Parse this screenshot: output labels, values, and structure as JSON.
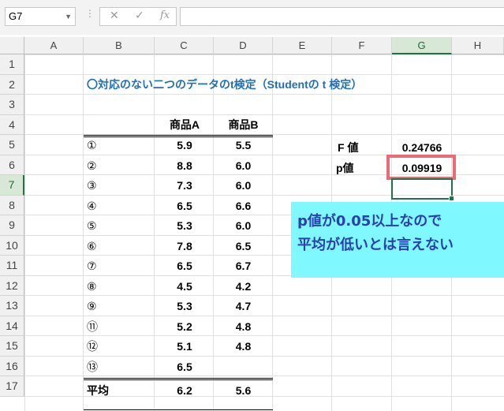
{
  "formula_bar": {
    "name_box": "G7",
    "cancel_icon": "✕",
    "enter_icon": "✓",
    "fx_label": "fx",
    "formula": ""
  },
  "columns": [
    "A",
    "B",
    "C",
    "D",
    "E",
    "F",
    "G",
    "H"
  ],
  "rows": [
    "1",
    "2",
    "3",
    "4",
    "5",
    "6",
    "7",
    "8",
    "9",
    "10",
    "11",
    "12",
    "13",
    "14",
    "15",
    "16",
    "17"
  ],
  "selected": {
    "column": "G",
    "row": "7"
  },
  "sheet": {
    "title": "〇対応のない二つのデータのt検定（Studentの t 検定）",
    "header_a": "商品A",
    "header_b": "商品B",
    "table_rows": [
      {
        "label": "①",
        "a": "5.9",
        "b": "5.5"
      },
      {
        "label": "②",
        "a": "8.8",
        "b": "6.0"
      },
      {
        "label": "③",
        "a": "7.3",
        "b": "6.0"
      },
      {
        "label": "④",
        "a": "6.5",
        "b": "6.6"
      },
      {
        "label": "⑤",
        "a": "5.3",
        "b": "6.0"
      },
      {
        "label": "⑥",
        "a": "7.8",
        "b": "6.5"
      },
      {
        "label": "⑦",
        "a": "6.5",
        "b": "6.7"
      },
      {
        "label": "⑧",
        "a": "4.5",
        "b": "4.2"
      },
      {
        "label": "⑨",
        "a": "5.3",
        "b": "4.7"
      },
      {
        "label": "⑪",
        "a": "5.2",
        "b": "4.8"
      },
      {
        "label": "⑫",
        "a": "5.1",
        "b": "4.8"
      },
      {
        "label": "⑬",
        "a": "6.5",
        "b": ""
      }
    ],
    "avg_label": "平均",
    "avg_a": "6.2",
    "avg_b": "5.6",
    "f_label": "F 値",
    "f_value": "0.24766",
    "p_label": "p値",
    "p_value": "0.09919"
  },
  "callout": {
    "line1": "p値が0.05以上なので",
    "line2": "平均が低いとは言えない"
  },
  "colors": {
    "title": "#1f6fb8",
    "highlight_border": "#ea6a77",
    "callout_bg": "#7ff9ff",
    "callout_text": "#2a3fb0",
    "selection": "#217346"
  }
}
